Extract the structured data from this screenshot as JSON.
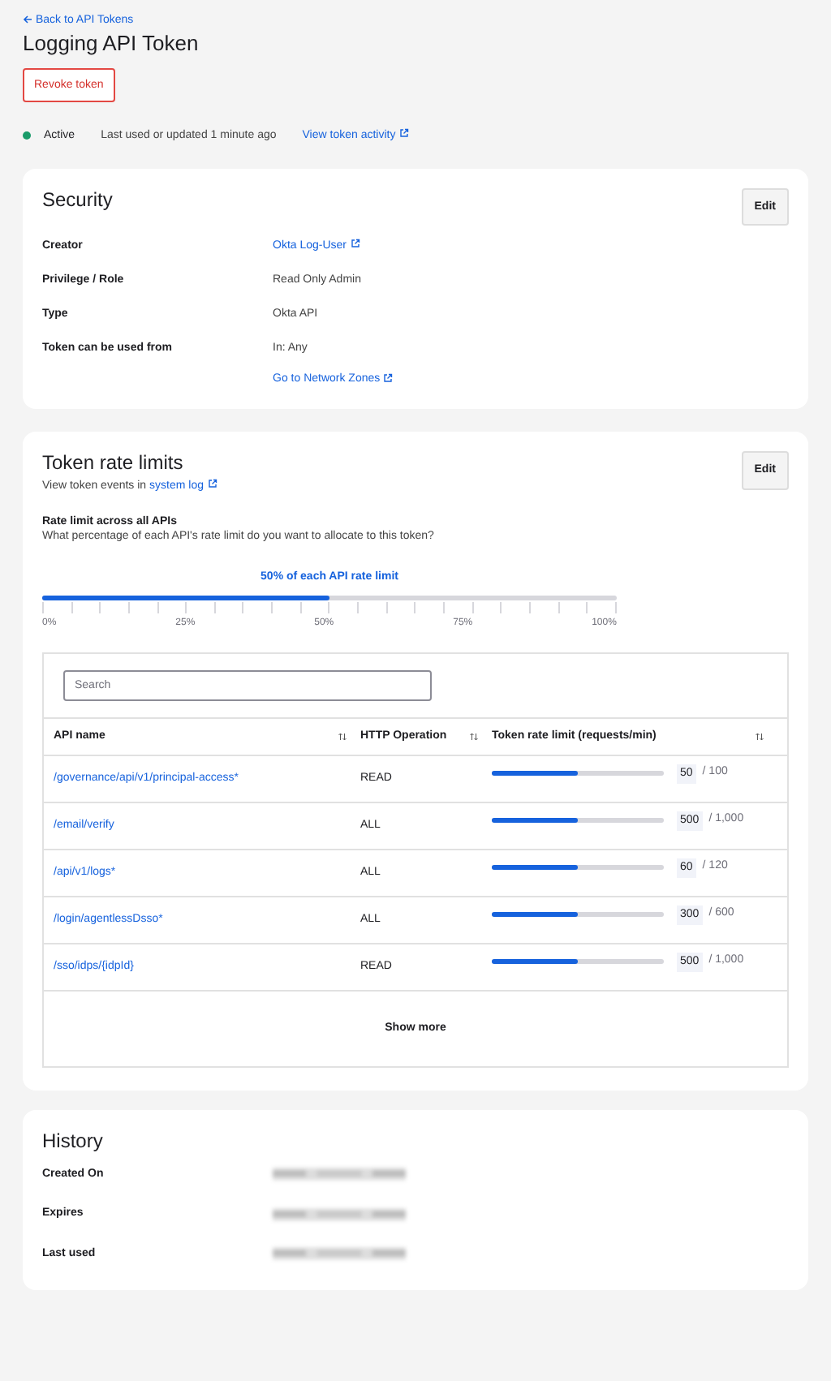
{
  "back_link": "Back to API Tokens",
  "title": "Logging API Token",
  "revoke_button": "Revoke token",
  "status": {
    "label": "Active",
    "color": "#1a9c6a",
    "updated": "Last used or updated 1 minute ago",
    "activity_link": "View token activity"
  },
  "security": {
    "title": "Security",
    "edit": "Edit",
    "rows": [
      {
        "label": "Creator",
        "values": [
          {
            "text": "Okta Log-User",
            "kind": "link"
          }
        ]
      },
      {
        "label": "Privilege / Role",
        "values": [
          {
            "text": "Read Only Admin",
            "kind": "text"
          }
        ]
      },
      {
        "label": "Type",
        "values": [
          {
            "text": "Okta API",
            "kind": "text"
          }
        ]
      },
      {
        "label": "Token can be used from",
        "values": [
          {
            "text": "In: Any",
            "kind": "text"
          },
          {
            "text": "Go to Network Zones",
            "kind": "link"
          }
        ]
      }
    ]
  },
  "rate_limits": {
    "title": "Token rate limits",
    "edit": "Edit",
    "events_text": "View token events in",
    "events_link": "system log",
    "heading": "Rate limit across all APIs",
    "question": "What percentage of each API's rate limit do you want to allocate to this token?",
    "slider": {
      "caption": "50% of each API rate limit",
      "level": 0.5,
      "tick_labels": [
        "0%",
        "25%",
        "50%",
        "75%",
        "100%"
      ]
    },
    "search": {
      "placeholder": "Search"
    },
    "columns": [
      "API name",
      "HTTP Operation",
      "Token rate limit (requests/min)"
    ],
    "rows": [
      {
        "api": "/governance/api/v1/principal-access*",
        "operation": "READ",
        "level": 0.5,
        "value": "50",
        "max": "/ 100"
      },
      {
        "api": "/email/verify",
        "operation": "ALL",
        "level": 0.5,
        "value": "500",
        "max": "/ 1,000"
      },
      {
        "api": "/api/v1/logs*",
        "operation": "ALL",
        "level": 0.5,
        "value": "60",
        "max": "/ 120"
      },
      {
        "api": "/login/agentlessDsso*",
        "operation": "ALL",
        "level": 0.5,
        "value": "300",
        "max": "/ 600"
      },
      {
        "api": "/sso/idps/{idpId}",
        "operation": "READ",
        "level": 0.5,
        "value": "500",
        "max": "/ 1,000"
      }
    ],
    "show_more": "Show more"
  },
  "history": {
    "title": "History",
    "rows": [
      {
        "label": "Created On",
        "redacted": true
      },
      {
        "label": "Expires",
        "redacted": true
      },
      {
        "label": "Last used",
        "redacted": true
      }
    ]
  }
}
